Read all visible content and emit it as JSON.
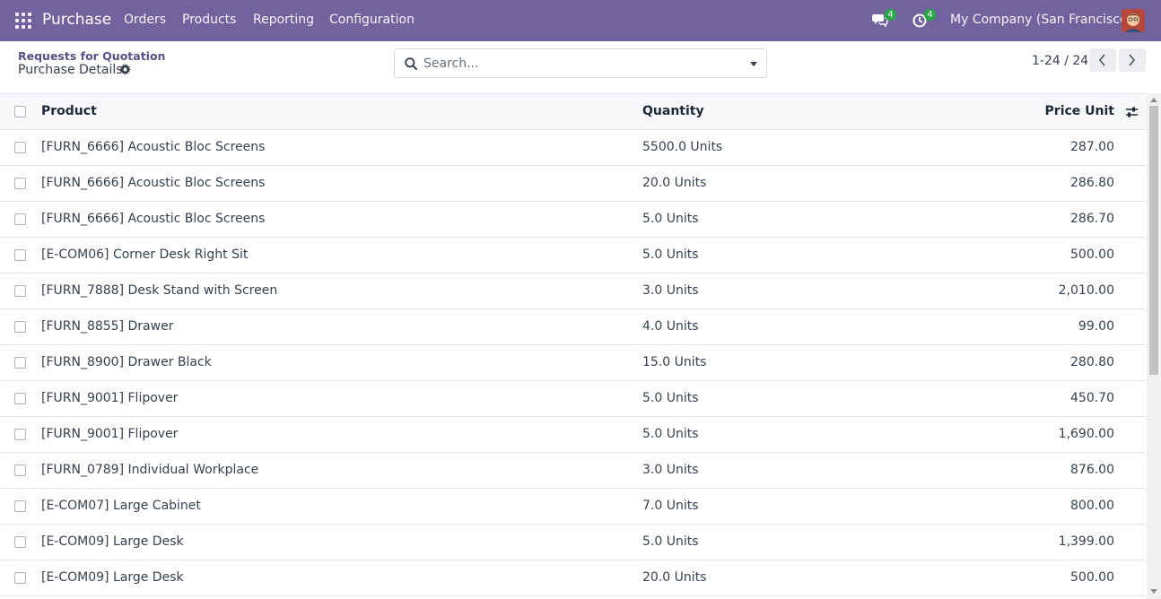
{
  "navbar": {
    "app_title": "Purchase",
    "menus": [
      "Orders",
      "Products",
      "Reporting",
      "Configuration"
    ],
    "chat_count": "4",
    "activity_count": "4",
    "company": "My Company (San Francisco)"
  },
  "breadcrumb": {
    "parent": "Requests for Quotation",
    "current": "Purchase Details"
  },
  "search": {
    "placeholder": "Search..."
  },
  "pager": {
    "text": "1-24 / 24"
  },
  "table": {
    "columns": {
      "product": "Product",
      "quantity": "Quantity",
      "price_unit": "Price Unit"
    },
    "rows": [
      {
        "product": "[FURN_6666] Acoustic Bloc Screens",
        "quantity": "5500.0 Units",
        "price_unit": "287.00"
      },
      {
        "product": "[FURN_6666] Acoustic Bloc Screens",
        "quantity": "20.0 Units",
        "price_unit": "286.80"
      },
      {
        "product": "[FURN_6666] Acoustic Bloc Screens",
        "quantity": "5.0 Units",
        "price_unit": "286.70"
      },
      {
        "product": "[E-COM06] Corner Desk Right Sit",
        "quantity": "5.0 Units",
        "price_unit": "500.00"
      },
      {
        "product": "[FURN_7888] Desk Stand with Screen",
        "quantity": "3.0 Units",
        "price_unit": "2,010.00"
      },
      {
        "product": "[FURN_8855] Drawer",
        "quantity": "4.0 Units",
        "price_unit": "99.00"
      },
      {
        "product": "[FURN_8900] Drawer Black",
        "quantity": "15.0 Units",
        "price_unit": "280.80"
      },
      {
        "product": "[FURN_9001] Flipover",
        "quantity": "5.0 Units",
        "price_unit": "450.70"
      },
      {
        "product": "[FURN_9001] Flipover",
        "quantity": "5.0 Units",
        "price_unit": "1,690.00"
      },
      {
        "product": "[FURN_0789] Individual Workplace",
        "quantity": "3.0 Units",
        "price_unit": "876.00"
      },
      {
        "product": "[E-COM07] Large Cabinet",
        "quantity": "7.0 Units",
        "price_unit": "800.00"
      },
      {
        "product": "[E-COM09] Large Desk",
        "quantity": "5.0 Units",
        "price_unit": "1,399.00"
      },
      {
        "product": "[E-COM09] Large Desk",
        "quantity": "20.0 Units",
        "price_unit": "500.00"
      }
    ]
  },
  "colors": {
    "navbar": "#71639e",
    "badge": "#28a745",
    "breadcrumb_link": "#5b4f8a"
  }
}
